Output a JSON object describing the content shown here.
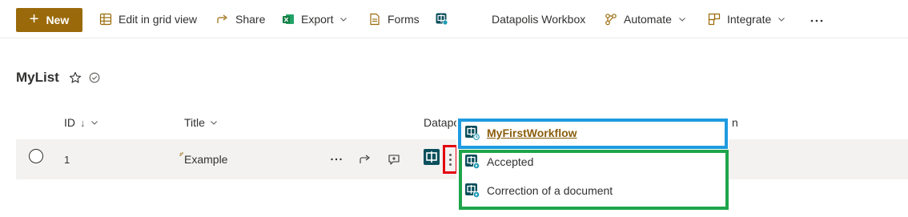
{
  "toolbar": {
    "new_label": "New",
    "edit_grid_label": "Edit in grid view",
    "share_label": "Share",
    "export_label": "Export",
    "forms_label": "Forms",
    "datapolis_label": "Datapolis Workbox",
    "automate_label": "Automate",
    "integrate_label": "Integrate"
  },
  "page": {
    "title": "MyList"
  },
  "list": {
    "columns": {
      "id": "ID",
      "id_sort": "↓",
      "title": "Title",
      "datapolis": "Datapo",
      "hidden_tail": "n"
    },
    "rows": [
      {
        "id": "1",
        "title": "Example"
      }
    ]
  },
  "workflow_menu": {
    "items": [
      {
        "label": "MyFirstWorkflow"
      },
      {
        "label": "Accepted"
      },
      {
        "label": "Correction of a document"
      }
    ]
  },
  "colors": {
    "brand": "#9a6a0a",
    "link": "#8a5d0c",
    "datapolis_icon": "#0b4f5c",
    "highlight_blue": "#1e9be0",
    "highlight_green": "#1ea54a",
    "highlight_red": "#e3000f"
  },
  "icons": {
    "edit_grid": "grid-icon",
    "share": "share-icon",
    "export": "excel-icon",
    "forms": "forms-icon",
    "datapolis": "datapolis-icon",
    "automate": "flow-icon",
    "integrate": "integrate-icon",
    "more": "more-icon"
  }
}
